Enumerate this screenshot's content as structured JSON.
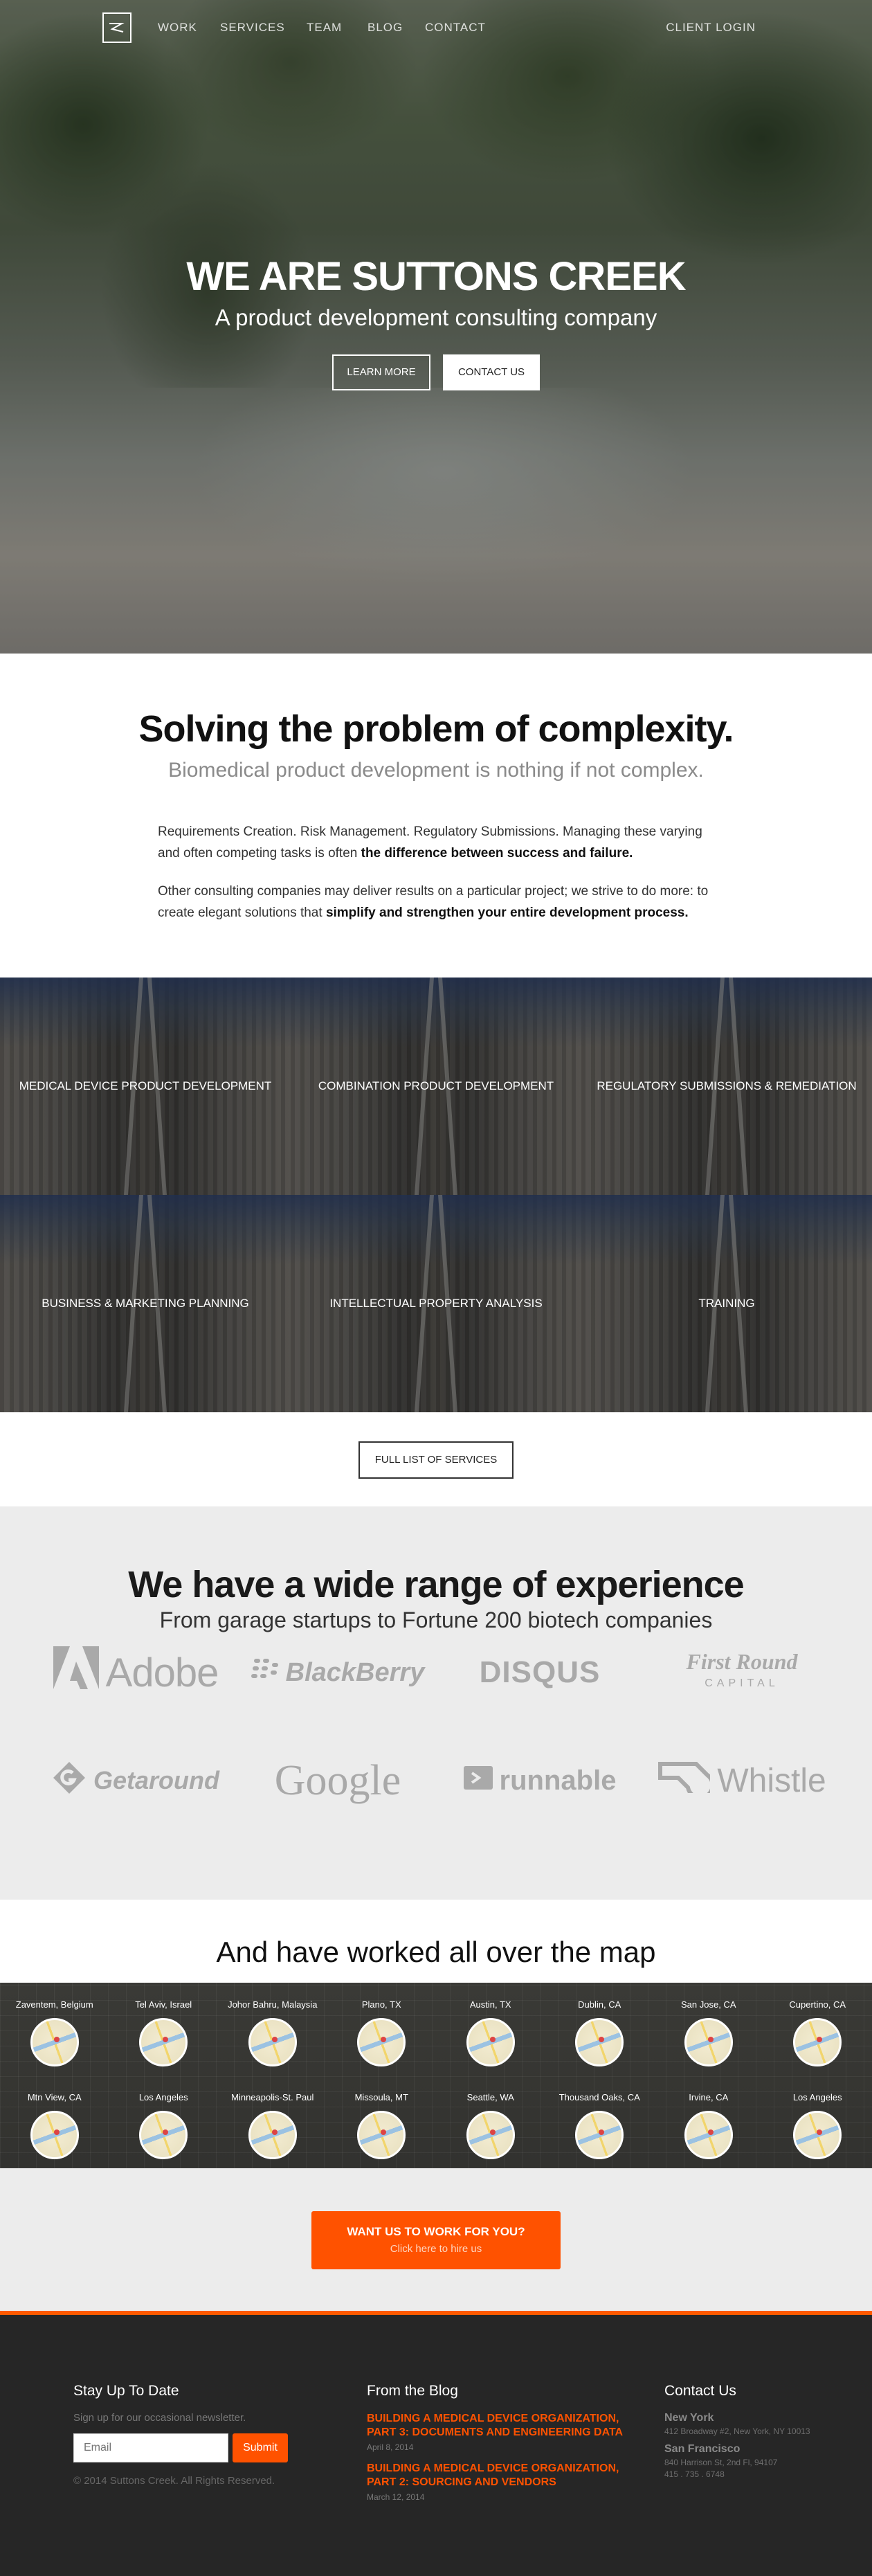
{
  "nav": {
    "items": [
      "WORK",
      "SERVICES",
      "TEAM",
      "BLOG",
      "CONTACT"
    ],
    "client_login": "CLIENT LOGIN"
  },
  "hero": {
    "title": "WE ARE SUTTONS CREEK",
    "subtitle": "A product development consulting company",
    "learn_more": "LEARN MORE",
    "contact_us": "CONTACT US"
  },
  "complexity": {
    "heading": "Solving the problem of complexity.",
    "lead": "Biomedical product development is nothing if not complex.",
    "p1_text": "Requirements Creation. Risk Management. Regulatory Submissions. Managing these varying and often competing tasks is often ",
    "p1_bold": "the difference between success and failure.",
    "p2_text": "Other consulting companies may deliver results on a particular project; we strive to do more: to create elegant solutions that ",
    "p2_bold": "simplify and strengthen your entire development process."
  },
  "services": {
    "tiles": [
      "MEDICAL DEVICE PRODUCT DEVELOPMENT",
      "COMBINATION PRODUCT DEVELOPMENT",
      "REGULATORY SUBMISSIONS & REMEDIATION",
      "BUSINESS & MARKETING PLANNING",
      "INTELLECTUAL PROPERTY ANALYSIS",
      "TRAINING"
    ],
    "full_list": "FULL LIST OF SERVICES"
  },
  "experience": {
    "heading": "We have a wide range of experience",
    "lead": "From garage startups to Fortune 200 biotech companies",
    "logos": {
      "adobe": "Adobe",
      "blackberry": "BlackBerry",
      "disqus": "DISQUS",
      "first_round": "First Round",
      "first_round_sub": "CAPITAL",
      "getaround": "Getaround",
      "google": "Google",
      "runnable": "runnable",
      "whistle": "Whistle"
    }
  },
  "map": {
    "heading": "And have worked all over the map",
    "cities": [
      "Zaventem, Belgium",
      "Tel Aviv, Israel",
      "Johor Bahru, Malaysia",
      "Plano, TX",
      "Austin, TX",
      "Dublin, CA",
      "San Jose, CA",
      "Cupertino, CA",
      "Mtn View, CA",
      "Los Angeles",
      "Minneapolis-St. Paul",
      "Missoula, MT",
      "Seattle, WA",
      "Thousand Oaks, CA",
      "Irvine, CA",
      "Los Angeles"
    ]
  },
  "cta": {
    "line1": "WANT US TO WORK FOR YOU?",
    "line2": "Click here to hire us"
  },
  "footer": {
    "newsletter": {
      "heading": "Stay Up To Date",
      "text": "Sign up for our occasional newsletter.",
      "placeholder": "Email",
      "submit": "Submit",
      "copyright": "© 2014 Suttons Creek. All Rights Reserved."
    },
    "blog": {
      "heading": "From the Blog",
      "posts": [
        {
          "title": "BUILDING A MEDICAL DEVICE ORGANIZATION, PART 3: DOCUMENTS AND ENGINEERING DATA",
          "date": "April 8, 2014"
        },
        {
          "title": "BUILDING A MEDICAL DEVICE ORGANIZATION, PART 2: SOURCING AND VENDORS",
          "date": "March 12, 2014"
        }
      ]
    },
    "contact": {
      "heading": "Contact Us",
      "offices": [
        {
          "name": "New York",
          "lines": [
            "412 Broadway #2, New York, NY 10013"
          ]
        },
        {
          "name": "San Francisco",
          "lines": [
            "840 Harrison St, 2nd Fl, 94107",
            "415 . 735 . 6748"
          ]
        }
      ]
    }
  },
  "colors": {
    "accent": "#ff5200",
    "footer_bg": "#262626",
    "light_bg": "#ececec"
  }
}
